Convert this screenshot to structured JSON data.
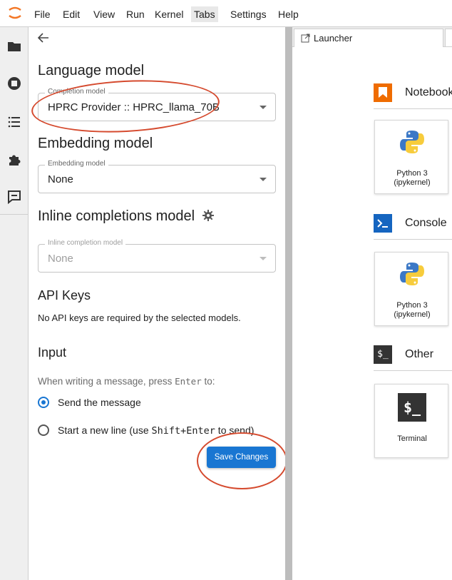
{
  "menubar": {
    "items": [
      "File",
      "Edit",
      "View",
      "Run",
      "Kernel",
      "Tabs",
      "Settings",
      "Help"
    ],
    "active": "Tabs"
  },
  "settings": {
    "language_model": {
      "heading": "Language model",
      "field_label": "Completion model",
      "value": "HPRC Provider :: HPRC_llama_70B"
    },
    "embedding_model": {
      "heading": "Embedding model",
      "field_label": "Embedding model",
      "value": "None"
    },
    "inline_model": {
      "heading": "Inline completions model",
      "field_label": "Inline completion model",
      "value": "None"
    },
    "api_keys": {
      "heading": "API Keys",
      "text": "No API keys are required by the selected models."
    },
    "input": {
      "heading": "Input",
      "prompt_prefix": "When writing a message, press ",
      "prompt_key": "Enter",
      "prompt_suffix": " to:",
      "option1": "Send the message",
      "option2_prefix": "Start a new line (use ",
      "option2_key": "Shift+Enter",
      "option2_suffix": " to send)"
    },
    "save_label": "Save Changes"
  },
  "launcher": {
    "tab_label": "Launcher",
    "sections": {
      "notebook": "Notebook",
      "console": "Console",
      "other": "Other"
    },
    "cards": {
      "python_line1": "Python 3",
      "python_line2": "(ipykernel)",
      "terminal": "Terminal",
      "terminal_glyph": "$_"
    }
  },
  "colors": {
    "accent": "#1976d2",
    "annotation": "#d54a2e",
    "notebook_orange": "#ef6c00",
    "console_blue": "#1565c0",
    "terminal_dark": "#333333"
  }
}
